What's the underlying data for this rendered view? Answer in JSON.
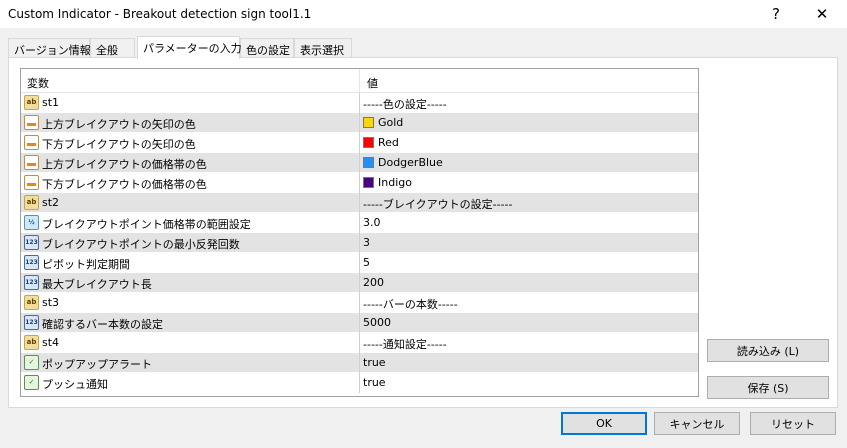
{
  "window": {
    "title": "Custom Indicator - Breakout detection sign tool1.1",
    "help_label": "?",
    "close_label": "✕"
  },
  "tabs": [
    {
      "label": "バージョン情報",
      "active": false
    },
    {
      "label": "全般",
      "active": false
    },
    {
      "label": "パラメーターの入力",
      "active": true
    },
    {
      "label": "色の設定",
      "active": false
    },
    {
      "label": "表示選択",
      "active": false
    }
  ],
  "grid": {
    "header": {
      "variable": "変数",
      "value": "値"
    },
    "rows": [
      {
        "icon": "ab",
        "name": "st1",
        "value": "-----色の設定-----",
        "swatch": ""
      },
      {
        "icon": "color",
        "name": "上方ブレイクアウトの矢印の色",
        "value": "Gold",
        "swatch": "#FFD700"
      },
      {
        "icon": "color",
        "name": "下方ブレイクアウトの矢印の色",
        "value": "Red",
        "swatch": "#FF0000"
      },
      {
        "icon": "color",
        "name": "上方ブレイクアウトの価格帯の色",
        "value": "DodgerBlue",
        "swatch": "#1E90FF"
      },
      {
        "icon": "color",
        "name": "下方ブレイクアウトの価格帯の色",
        "value": "Indigo",
        "swatch": "#4B0082"
      },
      {
        "icon": "ab",
        "name": "st2",
        "value": "-----ブレイクアウトの設定-----",
        "swatch": ""
      },
      {
        "icon": "half",
        "name": "ブレイクアウトポイント価格帯の範囲設定",
        "value": "3.0",
        "swatch": ""
      },
      {
        "icon": "123",
        "name": "ブレイクアウトポイントの最小反発回数",
        "value": "3",
        "swatch": ""
      },
      {
        "icon": "123",
        "name": "ピボット判定期間",
        "value": "5",
        "swatch": ""
      },
      {
        "icon": "123",
        "name": "最大ブレイクアウト長",
        "value": "200",
        "swatch": ""
      },
      {
        "icon": "ab",
        "name": "st3",
        "value": "-----バーの本数-----",
        "swatch": ""
      },
      {
        "icon": "123",
        "name": "確認するバー本数の設定",
        "value": "5000",
        "swatch": ""
      },
      {
        "icon": "ab",
        "name": "st4",
        "value": "-----通知設定-----",
        "swatch": ""
      },
      {
        "icon": "bool",
        "name": "ポップアップアラート",
        "value": "true",
        "swatch": ""
      },
      {
        "icon": "bool",
        "name": "プッシュ通知",
        "value": "true",
        "swatch": ""
      }
    ]
  },
  "buttons": {
    "load": "読み込み (L)",
    "save": "保存 (S)",
    "ok": "OK",
    "cancel": "キャンセル",
    "reset": "リセット"
  }
}
